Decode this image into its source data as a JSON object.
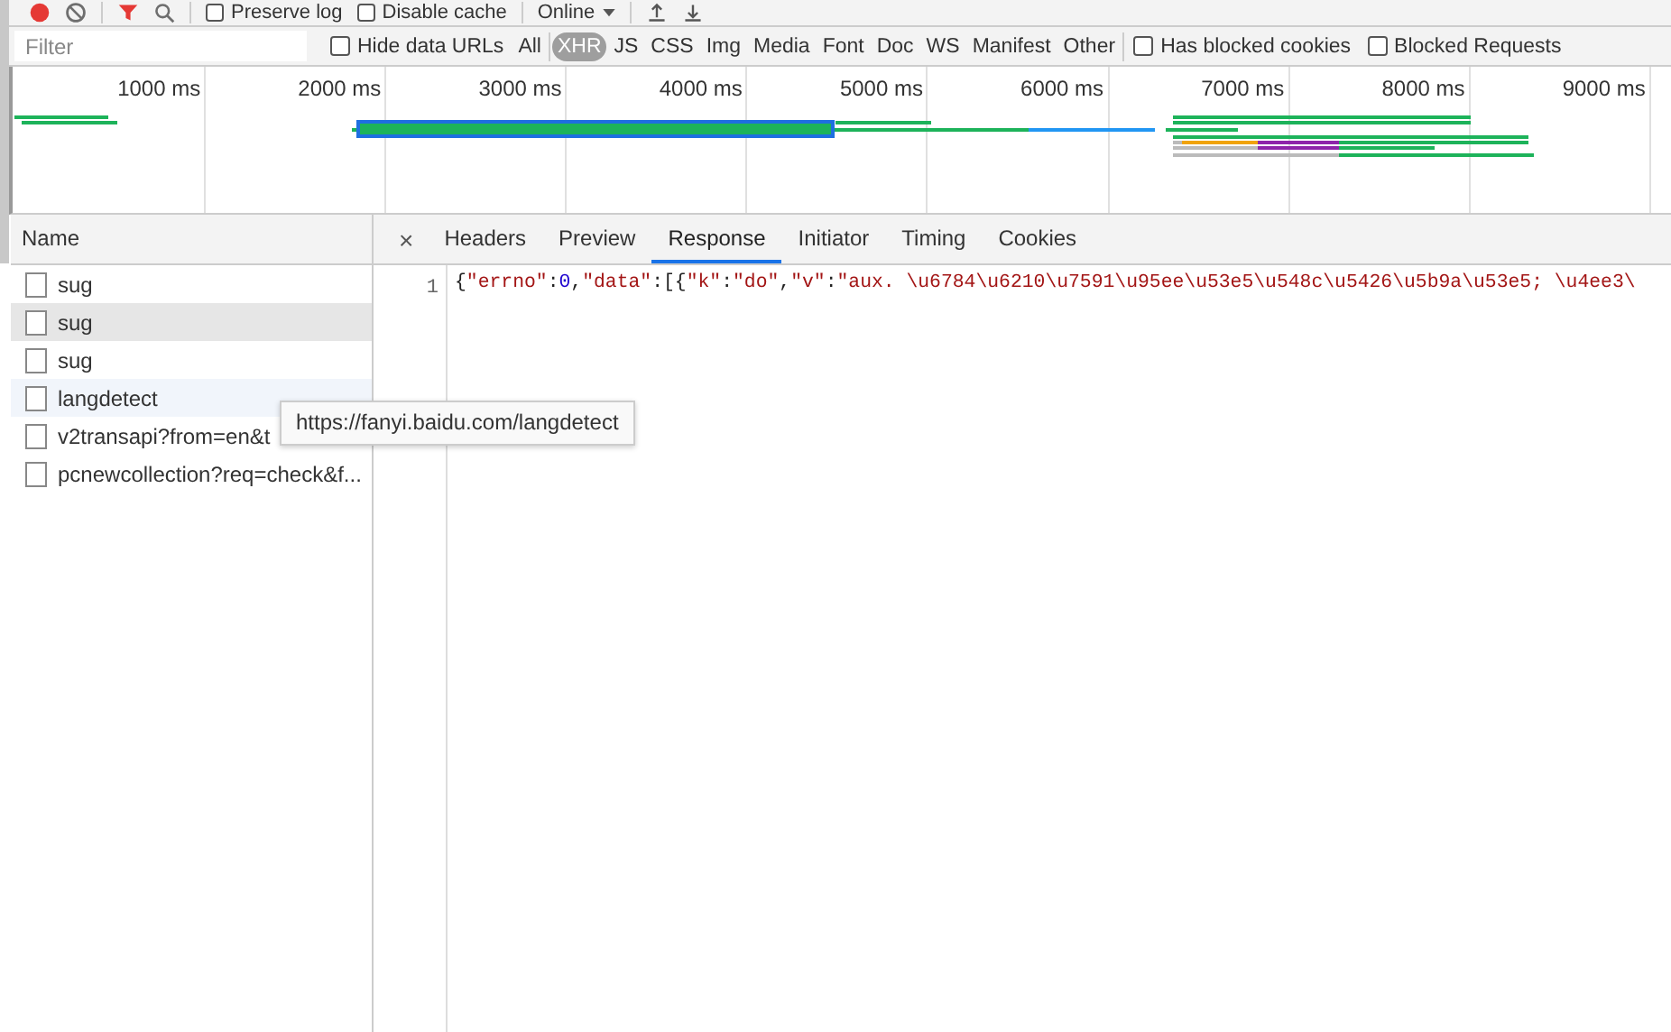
{
  "toolbar": {
    "record": {
      "on": true
    },
    "preserve_log": {
      "label": "Preserve log",
      "checked": false
    },
    "disable_cache": {
      "label": "Disable cache",
      "checked": false
    },
    "throttling": "Online"
  },
  "filter": {
    "placeholder": "Filter",
    "hide_data_urls": {
      "label": "Hide data URLs",
      "checked": false
    },
    "types": [
      {
        "label": "All",
        "selected": false
      },
      {
        "label": "XHR",
        "selected": true
      },
      {
        "label": "JS",
        "selected": false
      },
      {
        "label": "CSS",
        "selected": false
      },
      {
        "label": "Img",
        "selected": false
      },
      {
        "label": "Media",
        "selected": false
      },
      {
        "label": "Font",
        "selected": false
      },
      {
        "label": "Doc",
        "selected": false
      },
      {
        "label": "WS",
        "selected": false
      },
      {
        "label": "Manifest",
        "selected": false
      },
      {
        "label": "Other",
        "selected": false
      }
    ],
    "has_blocked_cookies": {
      "label": "Has blocked cookies",
      "checked": false
    },
    "blocked_requests": {
      "label": "Blocked Requests",
      "checked": false
    }
  },
  "overview": {
    "ticks": [
      "1000 ms",
      "2000 ms",
      "3000 ms",
      "4000 ms",
      "5000 ms",
      "6000 ms",
      "7000 ms",
      "8000 ms",
      "9000 ms"
    ]
  },
  "requests": {
    "column": "Name",
    "rows": [
      {
        "name": "sug",
        "selected": false,
        "hovered": false
      },
      {
        "name": "sug",
        "selected": true,
        "hovered": false
      },
      {
        "name": "sug",
        "selected": false,
        "hovered": false
      },
      {
        "name": "langdetect",
        "selected": false,
        "hovered": true
      },
      {
        "name": "v2transapi?from=en&t",
        "selected": false,
        "hovered": false
      },
      {
        "name": "pcnewcollection?req=check&f...",
        "selected": false,
        "hovered": false
      }
    ]
  },
  "tooltip": "https://fanyi.baidu.com/langdetect",
  "detail": {
    "close": "×",
    "tabs": [
      {
        "label": "Headers",
        "selected": false
      },
      {
        "label": "Preview",
        "selected": false
      },
      {
        "label": "Response",
        "selected": true
      },
      {
        "label": "Initiator",
        "selected": false
      },
      {
        "label": "Timing",
        "selected": false
      },
      {
        "label": "Cookies",
        "selected": false
      }
    ],
    "line_number": "1",
    "tokens": [
      {
        "kind": "punct",
        "text": "{"
      },
      {
        "kind": "string",
        "text": "\"errno\""
      },
      {
        "kind": "punct",
        "text": ":"
      },
      {
        "kind": "number",
        "text": "0"
      },
      {
        "kind": "punct",
        "text": ","
      },
      {
        "kind": "string",
        "text": "\"data\""
      },
      {
        "kind": "punct",
        "text": ":[{"
      },
      {
        "kind": "string",
        "text": "\"k\""
      },
      {
        "kind": "punct",
        "text": ":"
      },
      {
        "kind": "string",
        "text": "\"do\""
      },
      {
        "kind": "punct",
        "text": ","
      },
      {
        "kind": "string",
        "text": "\"v\""
      },
      {
        "kind": "punct",
        "text": ":"
      },
      {
        "kind": "string",
        "text": "\"aux. \\u6784\\u6210\\u7591\\u95ee\\u53e5\\u548c\\u5426\\u5b9a\\u53e5; \\u4ee3\\"
      }
    ]
  }
}
